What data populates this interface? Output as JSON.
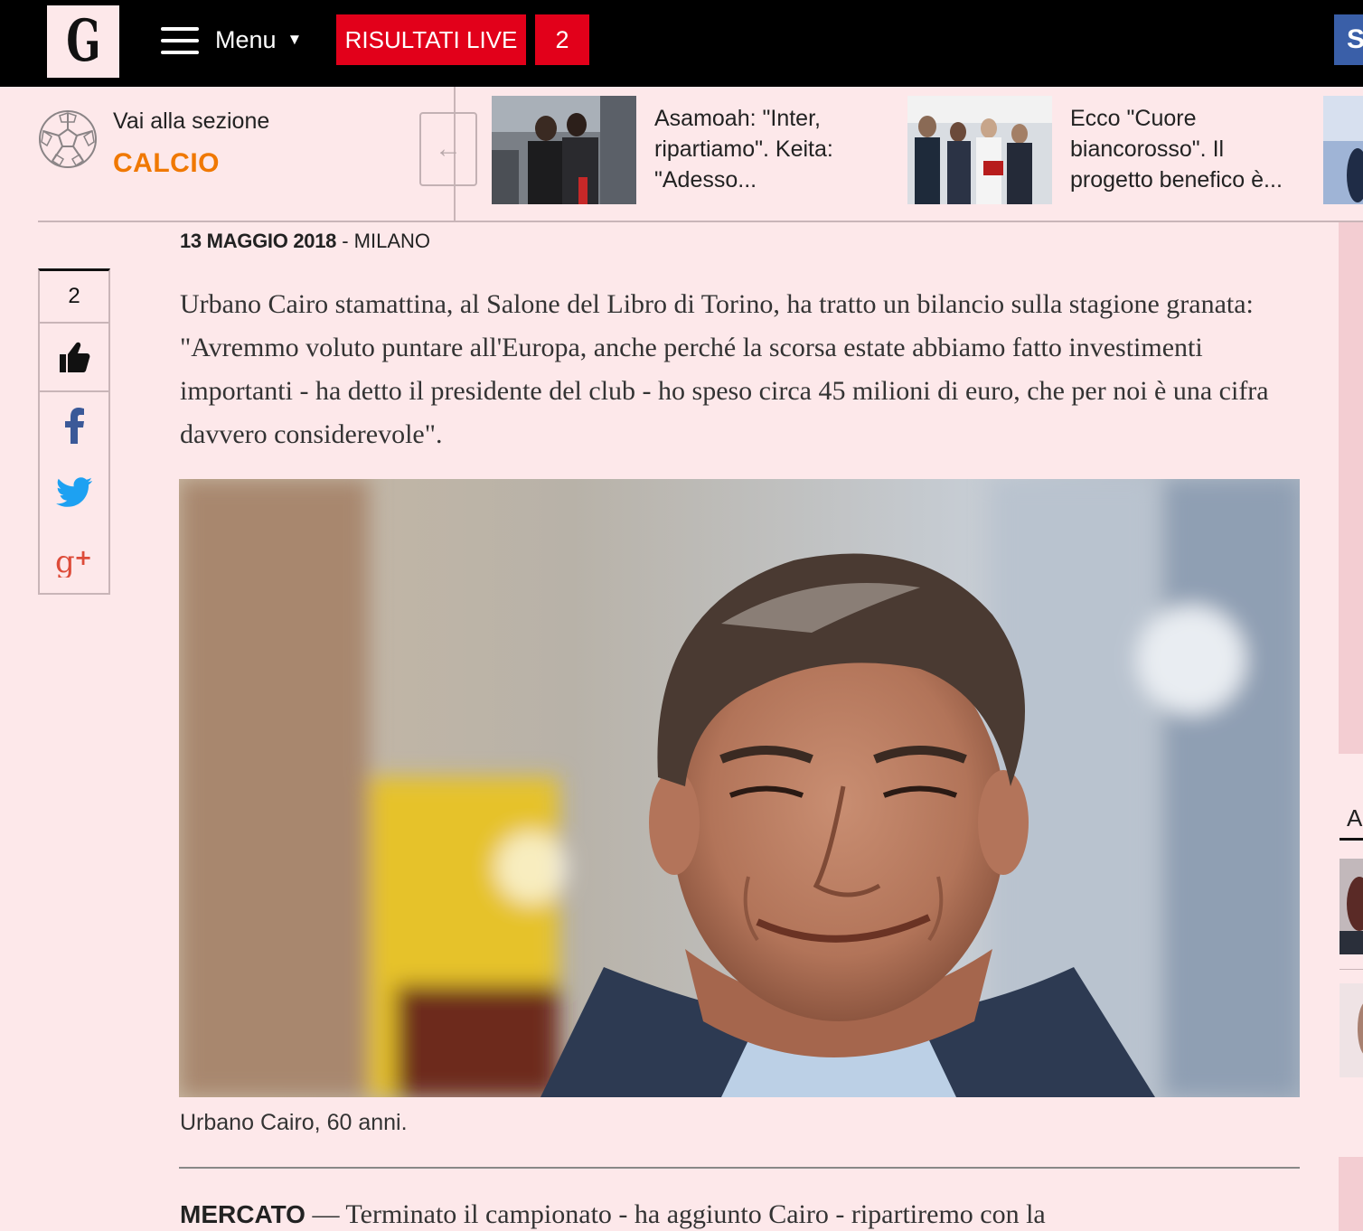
{
  "header": {
    "logo_letter": "G",
    "menu_label": "Menu",
    "menu_caret": "▼",
    "live_label": "RISULTATI LIVE",
    "live_count": "2",
    "right_button_letter": "S"
  },
  "section": {
    "goto_label": "Vai alla sezione",
    "name": "CALCIO",
    "prev_arrow": "←"
  },
  "news": [
    {
      "title": "Asamoah: \"Inter, ripartiamo\". Keita: \"Adesso..."
    },
    {
      "title": "Ecco \"Cuore biancorosso\". Il progetto benefico è..."
    }
  ],
  "article": {
    "date": "13 MAGGIO 2018",
    "separator": " - ",
    "location": "MILANO",
    "lead": "Urbano Cairo stamattina, al Salone del Libro di Torino, ha tratto un bilancio sulla stagione granata: \"Avremmo voluto puntare all'Europa, anche perché la scorsa estate abbiamo fatto investimenti importanti - ha detto il presidente del club - ho speso circa 45 milioni di euro, che per noi è una cifra davvero considerevole\".",
    "caption": "Urbano Cairo, 60 anni.",
    "subhead_label": "MERCATO",
    "subhead_text": " — Terminato il campionato - ha aggiunto Cairo - ripartiremo con la"
  },
  "social": {
    "count": "2",
    "icons": [
      "thumbs-up-icon",
      "facebook-icon",
      "twitter-icon",
      "google-plus-icon"
    ]
  },
  "sidebar": {
    "heading_letter": "A"
  },
  "colors": {
    "page_bg": "#fde8ea",
    "live_red": "#e2001a",
    "section_orange": "#f07800",
    "facebook_blue": "#3b5998",
    "twitter_blue": "#1da1f2",
    "gplus_red": "#dd4b39"
  }
}
